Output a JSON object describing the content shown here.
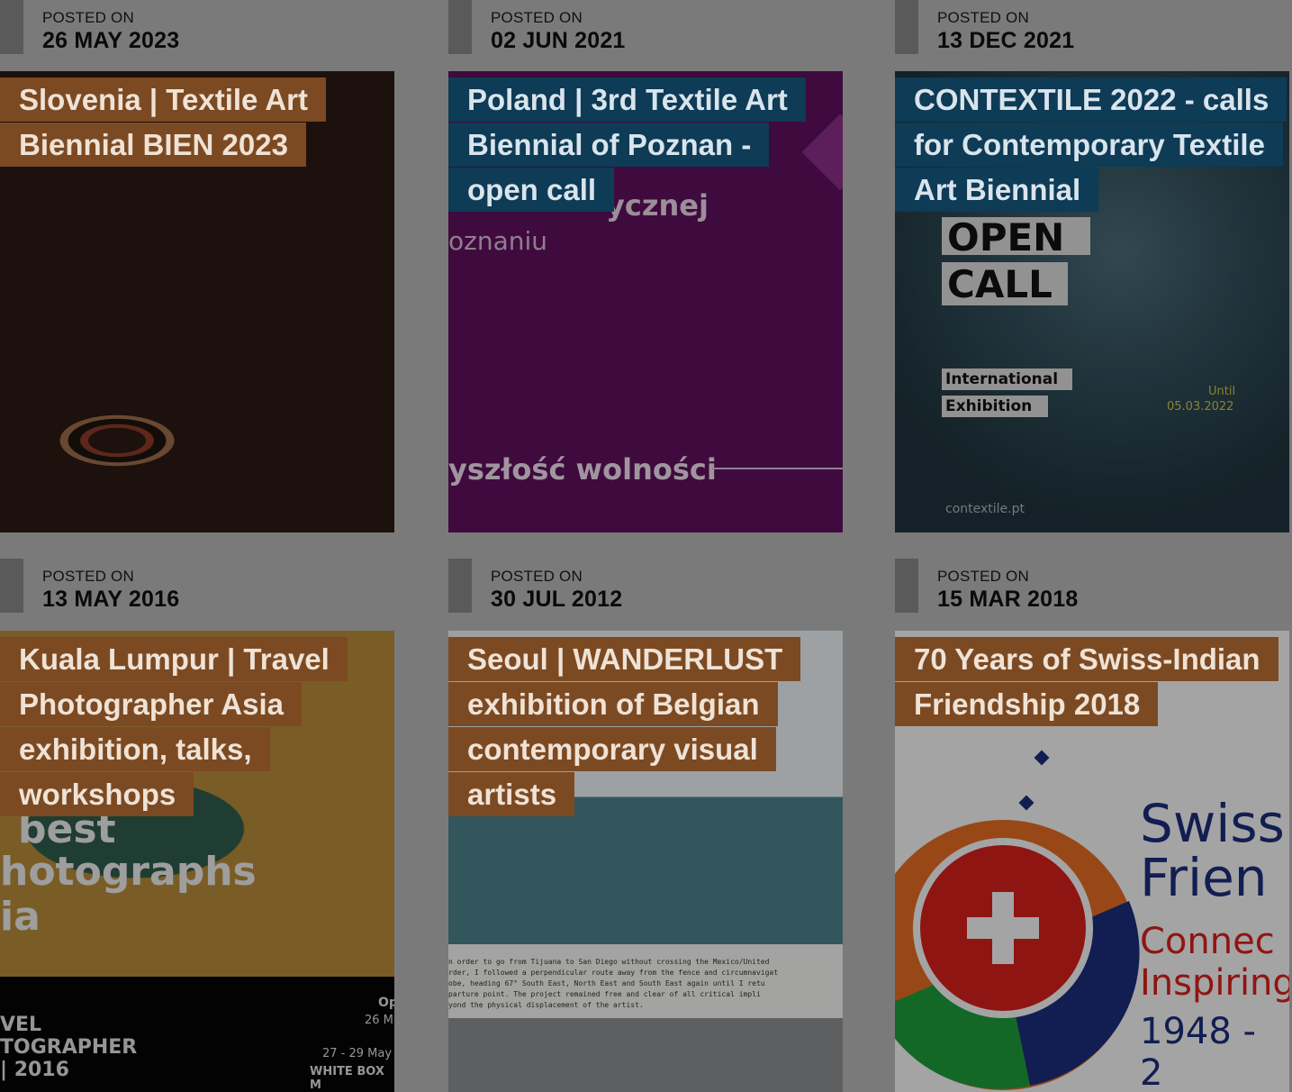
{
  "posts": [
    {
      "posted_label": "POSTED ON",
      "date": "26 MAY 2023",
      "title": "Slovenia | Textile Art Biennial BIEN 2023",
      "title_color": "#7c4a22"
    },
    {
      "posted_label": "POSTED ON",
      "date": "02 JUN 2021",
      "title": "Poland | 3rd Textile Art Biennial of Poznan - open call",
      "title_color": "#0e3b56",
      "image_text": {
        "line1": "ycznej",
        "line2": "oznaniu",
        "line3": "yszłość wolności"
      }
    },
    {
      "posted_label": "POSTED ON",
      "date": "13 DEC 2021",
      "title": "CONTEXTILE 2022 - calls for Contemporary Textile Art Biennial",
      "title_color": "#0e3b56",
      "image_text": {
        "open": "OPEN",
        "call": "CALL",
        "international": "International",
        "exhibition": "Exhibition",
        "until": "Until",
        "until_date": "05.03.2022",
        "site": "contextile.pt"
      }
    },
    {
      "posted_label": "POSTED ON",
      "date": "13 MAY 2016",
      "title": "Kuala Lumpur | Travel Photographer Asia exhibition, talks, workshops",
      "title_color": "#7c4a22",
      "image_text": {
        "best": "best",
        "photographs": "hotographs",
        "ia": "ia",
        "vel": "VEL",
        "tographer": "TOGRAPHER",
        "year": "| 2016",
        "op": "Op",
        "date1": "26 M",
        "date2": "27 - 29 May",
        "venue": "WHITE BOX M"
      }
    },
    {
      "posted_label": "POSTED ON",
      "date": "30 JUL 2012",
      "title": "Seoul | WANDERLUST exhibition of Belgian contemporary visual artists",
      "title_color": "#7c4a22",
      "image_text": {
        "caption1": "n order to go from Tijuana to San Diego without crossing the Mexico/United",
        "caption2": "rder, I followed a perpendicular route away from the fence and circumnavigat",
        "caption3": "obe, heading 67° South East, North East and South East again until I retu",
        "caption4": "parture point. The project remained free and clear of all critical impli",
        "caption5": "yond the physical displacement of the artist."
      }
    },
    {
      "posted_label": "POSTED ON",
      "date": "15 MAR 2018",
      "title": "70 Years of Swiss-Indian Friendship 2018",
      "title_color": "#7c4a22",
      "image_text": {
        "swiss": "Swiss",
        "frien": "Frien",
        "connec": "Connec",
        "inspiring": "Inspiring",
        "years": "1948 - 2"
      }
    }
  ]
}
